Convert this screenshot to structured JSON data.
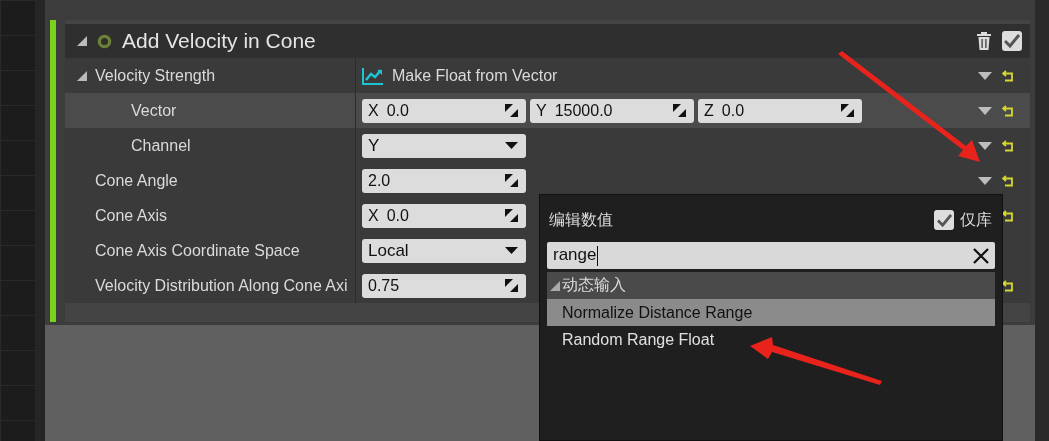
{
  "module": {
    "title": "Add Velocity in Cone",
    "expanded": true,
    "enabled": true,
    "rows": [
      {
        "label": "Velocity Strength",
        "expanded": true,
        "highlighted": false,
        "value": {
          "kind": "link",
          "text": "Make Float from Vector"
        },
        "menu_arrow": true,
        "reset": true,
        "children": [
          {
            "label": "Vector",
            "highlighted": true,
            "value": {
              "kind": "vector",
              "fields": [
                {
                  "axis": "X",
                  "text": "0.0"
                },
                {
                  "axis": "Y",
                  "text": "15000.0"
                },
                {
                  "axis": "Z",
                  "text": "0.0"
                }
              ]
            },
            "menu_arrow": true,
            "reset": true
          },
          {
            "label": "Channel",
            "highlighted": false,
            "value": {
              "kind": "dropdown",
              "text": "Y"
            },
            "menu_arrow": true,
            "reset": true
          }
        ]
      },
      {
        "label": "Cone Angle",
        "highlighted": false,
        "value": {
          "kind": "number",
          "text": "2.0"
        },
        "menu_arrow": true,
        "reset": true
      },
      {
        "label": "Cone Axis",
        "highlighted": false,
        "value": {
          "kind": "vector",
          "fields": [
            {
              "axis": "X",
              "text": "0.0"
            }
          ]
        },
        "menu_arrow": false,
        "reset": true
      },
      {
        "label": "Cone Axis Coordinate Space",
        "highlighted": false,
        "value": {
          "kind": "dropdown",
          "text": "Local"
        },
        "menu_arrow": false,
        "reset": false
      },
      {
        "label": "Velocity Distribution Along Cone Axi",
        "highlighted": false,
        "value": {
          "kind": "number",
          "text": "0.75"
        },
        "menu_arrow": false,
        "reset": true
      }
    ]
  },
  "popup": {
    "title": "编辑数值",
    "library_only": {
      "label": "仅库",
      "checked": true
    },
    "search": {
      "value": "range"
    },
    "categories": [
      {
        "label": "动态输入",
        "expanded": true,
        "items": [
          {
            "label": "Normalize Distance Range",
            "selected": true
          },
          {
            "label": "Random Range Float",
            "selected": false
          }
        ]
      }
    ]
  }
}
